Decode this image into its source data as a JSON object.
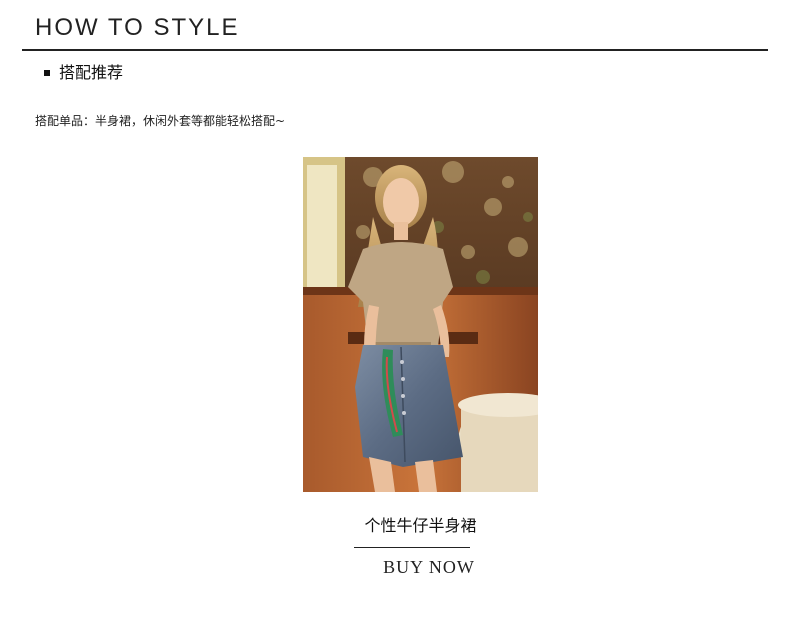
{
  "section": {
    "title": "HOW TO STYLE"
  },
  "subsection": {
    "heading": "搭配推荐"
  },
  "description": "搭配单品：半身裙，休闲外套等都能轻松搭配~",
  "product": {
    "name": "个性牛仔半身裙",
    "cta_label": "BUY NOW",
    "photo_alt": "model-wearing-denim-skirt-photo"
  },
  "colors": {
    "text": "#222222",
    "rule": "#222222",
    "background": "#ffffff"
  }
}
